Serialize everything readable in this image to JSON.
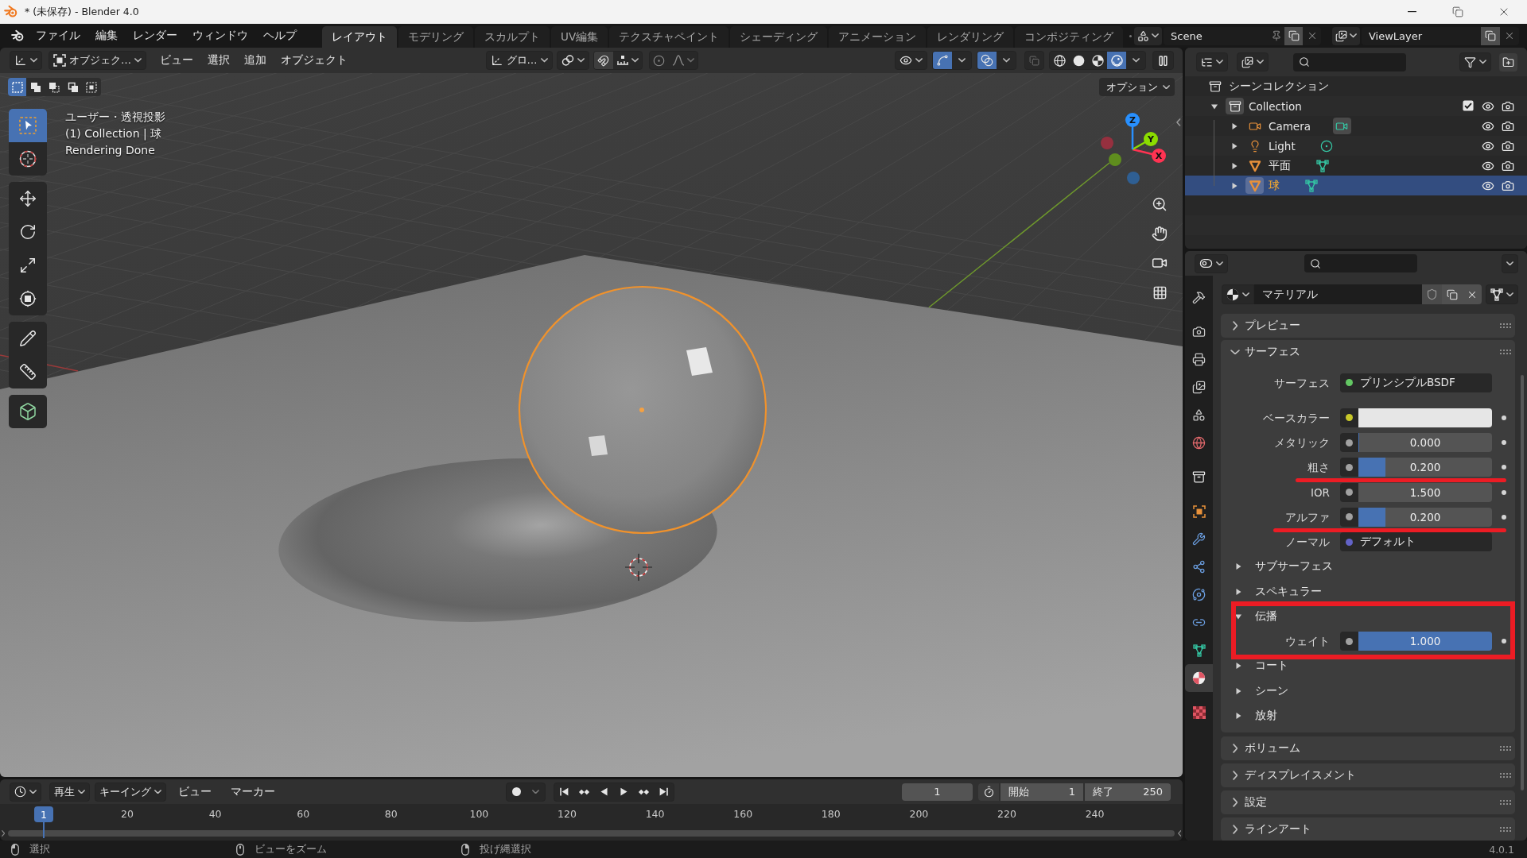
{
  "window": {
    "title": "* (未保存) - Blender 4.0"
  },
  "top_bar": {
    "menus": [
      "ファイル",
      "編集",
      "レンダー",
      "ウィンドウ",
      "ヘルプ"
    ],
    "workspaces": [
      {
        "label": "レイアウト",
        "selected": true
      },
      {
        "label": "モデリング",
        "selected": false
      },
      {
        "label": "スカルプト",
        "selected": false
      },
      {
        "label": "UV編集",
        "selected": false
      },
      {
        "label": "テクスチャペイント",
        "selected": false
      },
      {
        "label": "シェーディング",
        "selected": false
      },
      {
        "label": "アニメーション",
        "selected": false
      },
      {
        "label": "レンダリング",
        "selected": false
      },
      {
        "label": "コンポジティング",
        "selected": false
      }
    ],
    "scene": "Scene",
    "view_layer": "ViewLayer"
  },
  "viewport": {
    "mode": "オブジェク…",
    "menus": [
      "ビュー",
      "選択",
      "追加",
      "オブジェクト"
    ],
    "orientation": "グロ…",
    "gizmos": {
      "on": true
    },
    "overlays": {
      "on": true
    },
    "shading": [
      {
        "kind": "wireframe",
        "selected": false
      },
      {
        "kind": "solid",
        "selected": false
      },
      {
        "kind": "material",
        "selected": false
      },
      {
        "kind": "rendered",
        "selected": true
      }
    ],
    "select_modes": [
      {
        "kind": "set",
        "selected": true
      },
      {
        "kind": "extend",
        "selected": false
      },
      {
        "kind": "subtract",
        "selected": false
      },
      {
        "kind": "difference",
        "selected": false
      },
      {
        "kind": "intersect",
        "selected": false
      }
    ],
    "options": "オプション",
    "tool_groups": [
      [
        {
          "kind": "select",
          "selected": true
        },
        {
          "kind": "cursor",
          "selected": false
        }
      ],
      [
        {
          "kind": "move",
          "selected": false
        },
        {
          "kind": "rotate",
          "selected": false
        },
        {
          "kind": "scale",
          "selected": false
        },
        {
          "kind": "transform",
          "selected": false
        }
      ],
      [
        {
          "kind": "annotate",
          "selected": false
        },
        {
          "kind": "measure",
          "selected": false
        }
      ],
      [
        {
          "kind": "add_cube",
          "selected": false
        }
      ]
    ],
    "info": [
      "ユーザー・透視投影",
      "(1) Collection | 球",
      "Rendering Done"
    ],
    "gizmo_axes": [
      {
        "label": "X",
        "color": "#ff3352"
      },
      {
        "label": "Y",
        "color": "#8bdc00"
      },
      {
        "label": "Z",
        "color": "#2890ff"
      }
    ],
    "gizmo_negative_axes": [
      {
        "color": "#96303f"
      },
      {
        "color": "#5f8d1e"
      },
      {
        "color": "#2f5f93"
      }
    ]
  },
  "outliner": {
    "tree": [
      {
        "label": "シーンコレクション",
        "kind": "scene_collection",
        "selected": false,
        "children": [
          {
            "label": "Collection",
            "kind": "collection",
            "expanded": true,
            "selected": false,
            "checked": true,
            "visible": true,
            "renderable": true,
            "children": [
              {
                "label": "Camera",
                "kind": "camera",
                "expanded": false,
                "selected": false,
                "visible": true,
                "renderable": true
              },
              {
                "label": "Light",
                "kind": "light",
                "expanded": false,
                "selected": false,
                "visible": true,
                "renderable": true
              },
              {
                "label": "平面",
                "kind": "mesh",
                "expanded": false,
                "selected": false,
                "visible": true,
                "renderable": true
              },
              {
                "label": "球",
                "kind": "mesh",
                "expanded": false,
                "selected": true,
                "visible": true,
                "renderable": true
              }
            ]
          }
        ]
      }
    ]
  },
  "properties": {
    "tab_groups": [
      [
        {
          "kind": "tool",
          "selected": false
        }
      ],
      [
        {
          "kind": "render",
          "selected": false
        },
        {
          "kind": "output",
          "selected": false
        },
        {
          "kind": "view_layer",
          "selected": false
        },
        {
          "kind": "scene",
          "selected": false
        },
        {
          "kind": "world",
          "selected": false
        }
      ],
      [
        {
          "kind": "collection",
          "selected": false
        }
      ],
      [
        {
          "kind": "object",
          "selected": false
        },
        {
          "kind": "modifiers",
          "selected": false
        },
        {
          "kind": "particles",
          "selected": false
        },
        {
          "kind": "physics",
          "selected": false
        },
        {
          "kind": "constraints",
          "selected": false
        },
        {
          "kind": "data",
          "selected": false
        },
        {
          "kind": "material",
          "selected": true
        }
      ],
      [
        {
          "kind": "texture",
          "selected": false
        }
      ]
    ],
    "material": "マテリアル",
    "panels": [
      {
        "label": "プレビュー",
        "expanded": false
      },
      {
        "label": "サーフェス",
        "expanded": true,
        "rows": [
          {
            "kind": "shader",
            "label": "サーフェス",
            "value": "プリンシプルBSDF",
            "color": "#63c763",
            "marked": false
          },
          {
            "kind": "color",
            "label": "ベースカラー",
            "swatch": {
              "color": "#e6e6e6"
            },
            "color": "#c7c729",
            "marked": false
          },
          {
            "kind": "slider",
            "label": "メタリック",
            "value": "0.000",
            "level": 0,
            "color": "#a1a1a1",
            "marked": false
          },
          {
            "kind": "slider",
            "label": "粗さ",
            "value": "0.200",
            "level": 0.2,
            "color": "#a1a1a1",
            "marked": true
          },
          {
            "kind": "number",
            "label": "IOR",
            "value": "1.500",
            "color": "#a1a1a1",
            "marked": false
          },
          {
            "kind": "slider",
            "label": "アルファ",
            "value": "0.200",
            "level": 0.2,
            "color": "#a1a1a1",
            "marked": true
          },
          {
            "kind": "link",
            "label": "ノーマル",
            "value": "デフォルト",
            "color": "#6363c7",
            "marked": false
          },
          {
            "kind": "group",
            "label": "サブサーフェス",
            "expanded": false,
            "framed": false
          },
          {
            "kind": "group",
            "label": "スペキュラー",
            "expanded": false,
            "framed": false
          },
          {
            "kind": "group",
            "label": "伝播",
            "expanded": true,
            "framed": true,
            "rows": [
              {
                "kind": "slider",
                "label": "ウェイト",
                "value": "1.000",
                "level": 1,
                "color": "#a1a1a1",
                "marked": false
              }
            ]
          },
          {
            "kind": "group",
            "label": "コート",
            "expanded": false,
            "framed": false
          },
          {
            "kind": "group",
            "label": "シーン",
            "expanded": false,
            "framed": false
          },
          {
            "kind": "group",
            "label": "放射",
            "expanded": false,
            "framed": false
          }
        ]
      },
      {
        "label": "ボリューム",
        "expanded": false
      },
      {
        "label": "ディスプレイスメント",
        "expanded": false
      },
      {
        "label": "設定",
        "expanded": false
      },
      {
        "label": "ラインアート",
        "expanded": false
      }
    ]
  },
  "timeline": {
    "menus": [
      {
        "label": "再生",
        "kind": "dropdown"
      },
      {
        "label": "キーイング",
        "kind": "dropdown"
      },
      {
        "label": "ビュー",
        "kind": "menu"
      },
      {
        "label": "マーカー",
        "kind": "menu"
      }
    ],
    "current_frame": "1",
    "start_label": "開始",
    "start": "1",
    "end_label": "終了",
    "end": "250",
    "playhead": "1",
    "ruler": [
      "20",
      "40",
      "60",
      "80",
      "100",
      "120",
      "140",
      "160",
      "180",
      "200",
      "220",
      "240"
    ]
  },
  "status_bar": {
    "hints": [
      {
        "label": "選択",
        "kind": "left"
      },
      {
        "label": "ビューをズーム",
        "kind": "middle"
      },
      {
        "label": "投げ縄選択",
        "kind": "right"
      }
    ],
    "version": "4.0.1"
  }
}
